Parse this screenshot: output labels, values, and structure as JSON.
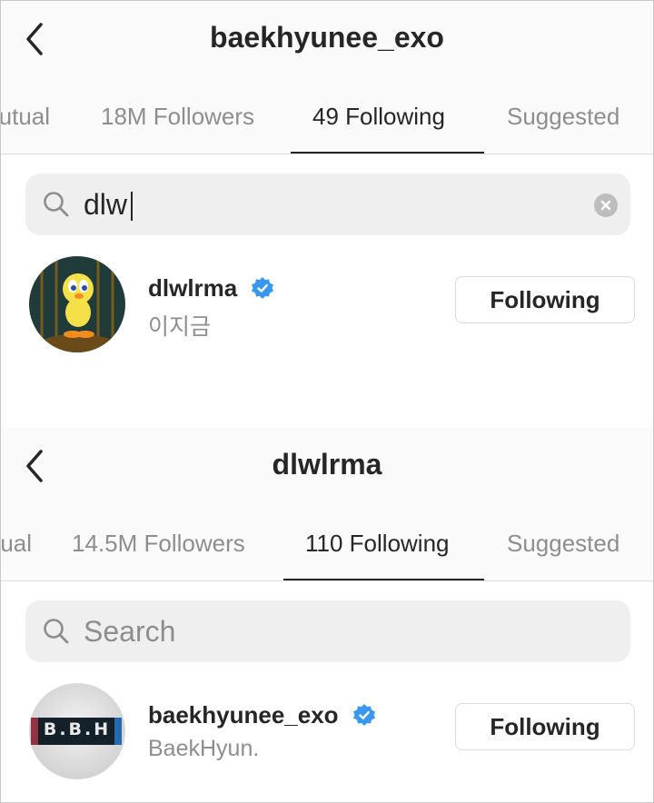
{
  "screen1": {
    "title": "baekhyunee_exo",
    "tabs": [
      {
        "label": "Mutual",
        "active": false
      },
      {
        "label": "18M Followers",
        "active": false
      },
      {
        "label": "49 Following",
        "active": true
      },
      {
        "label": "Suggested",
        "active": false
      }
    ],
    "search": {
      "value": "dlw",
      "placeholder": "Search"
    },
    "result": {
      "username": "dlwlrma",
      "full_name": "이지금",
      "verified": true,
      "button_label": "Following"
    }
  },
  "screen2": {
    "title": "dlwlrma",
    "tabs": [
      {
        "label": "Mutual",
        "active": false
      },
      {
        "label": "14.5M Followers",
        "active": false
      },
      {
        "label": "110 Following",
        "active": true
      },
      {
        "label": "Suggested",
        "active": false
      }
    ],
    "search": {
      "value": "",
      "placeholder": "Search"
    },
    "result": {
      "username": "baekhyunee_exo",
      "full_name": "BaekHyun.",
      "verified": true,
      "button_label": "Following",
      "avatar_text": "B.B.H"
    }
  },
  "colors": {
    "text": "#262626",
    "secondary": "#8e8e8e",
    "verified": "#3897f0",
    "search_bg": "#efefef"
  },
  "icons": [
    "back-arrow-icon",
    "search-icon",
    "clear-icon",
    "verified-badge-icon"
  ]
}
